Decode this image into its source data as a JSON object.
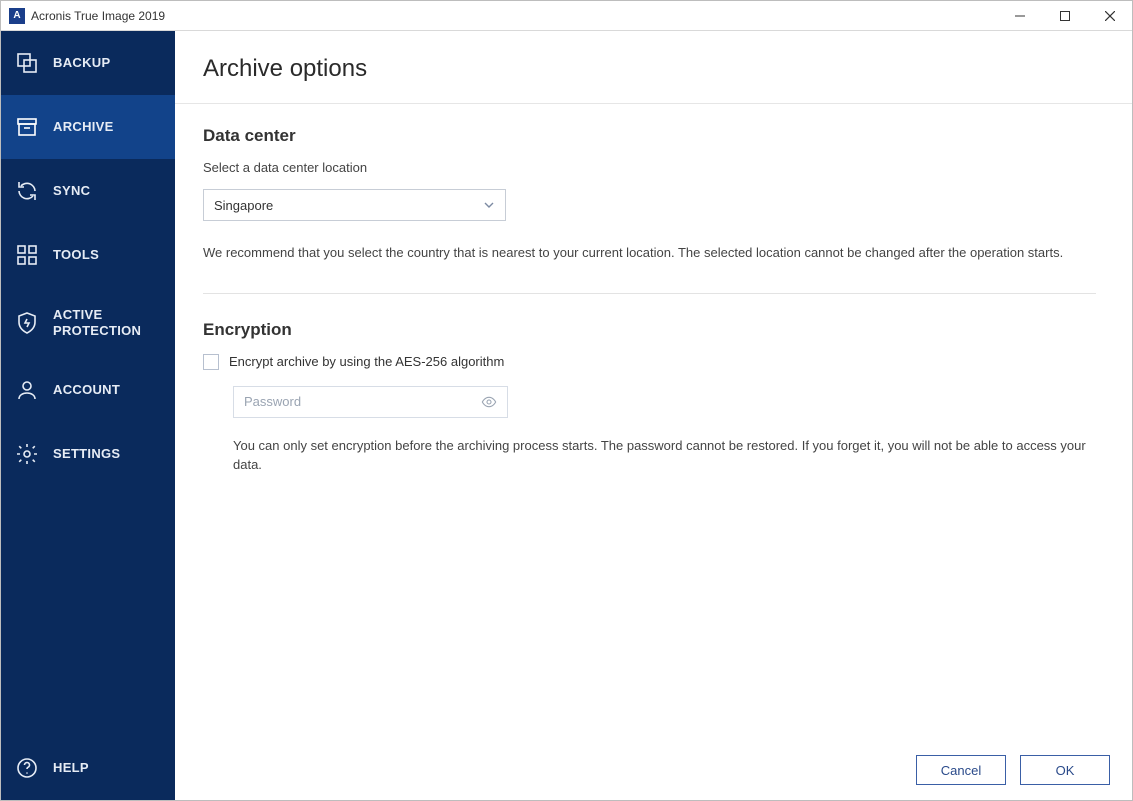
{
  "window": {
    "title": "Acronis True Image 2019",
    "app_icon_letter": "A"
  },
  "sidebar": {
    "items": [
      {
        "key": "backup",
        "label": "BACKUP",
        "icon": "backup-icon"
      },
      {
        "key": "archive",
        "label": "ARCHIVE",
        "icon": "archive-icon",
        "active": true
      },
      {
        "key": "sync",
        "label": "SYNC",
        "icon": "sync-icon"
      },
      {
        "key": "tools",
        "label": "TOOLS",
        "icon": "tools-icon"
      },
      {
        "key": "active-protection",
        "label": "ACTIVE PROTECTION",
        "icon": "shield-icon"
      },
      {
        "key": "account",
        "label": "ACCOUNT",
        "icon": "account-icon"
      },
      {
        "key": "settings",
        "label": "SETTINGS",
        "icon": "settings-icon"
      }
    ],
    "help_label": "HELP"
  },
  "main": {
    "page_title": "Archive options",
    "data_center": {
      "section_title": "Data center",
      "prompt": "Select a data center location",
      "selected": "Singapore",
      "info": "We recommend that you select the country that is nearest to your current location. The selected location cannot be changed after the operation starts."
    },
    "encryption": {
      "section_title": "Encryption",
      "checkbox_label": "Encrypt archive by using the AES-256 algorithm",
      "checked": false,
      "password_value": "",
      "password_placeholder": "Password",
      "description": "You can only set encryption before the archiving process starts. The password cannot be restored. If you forget it, you will not be able to access your data."
    },
    "footer": {
      "cancel_label": "Cancel",
      "ok_label": "OK"
    }
  },
  "colors": {
    "sidebar_bg": "#0a2a5c",
    "sidebar_active": "#12438a",
    "accent": "#3a5fa6"
  }
}
